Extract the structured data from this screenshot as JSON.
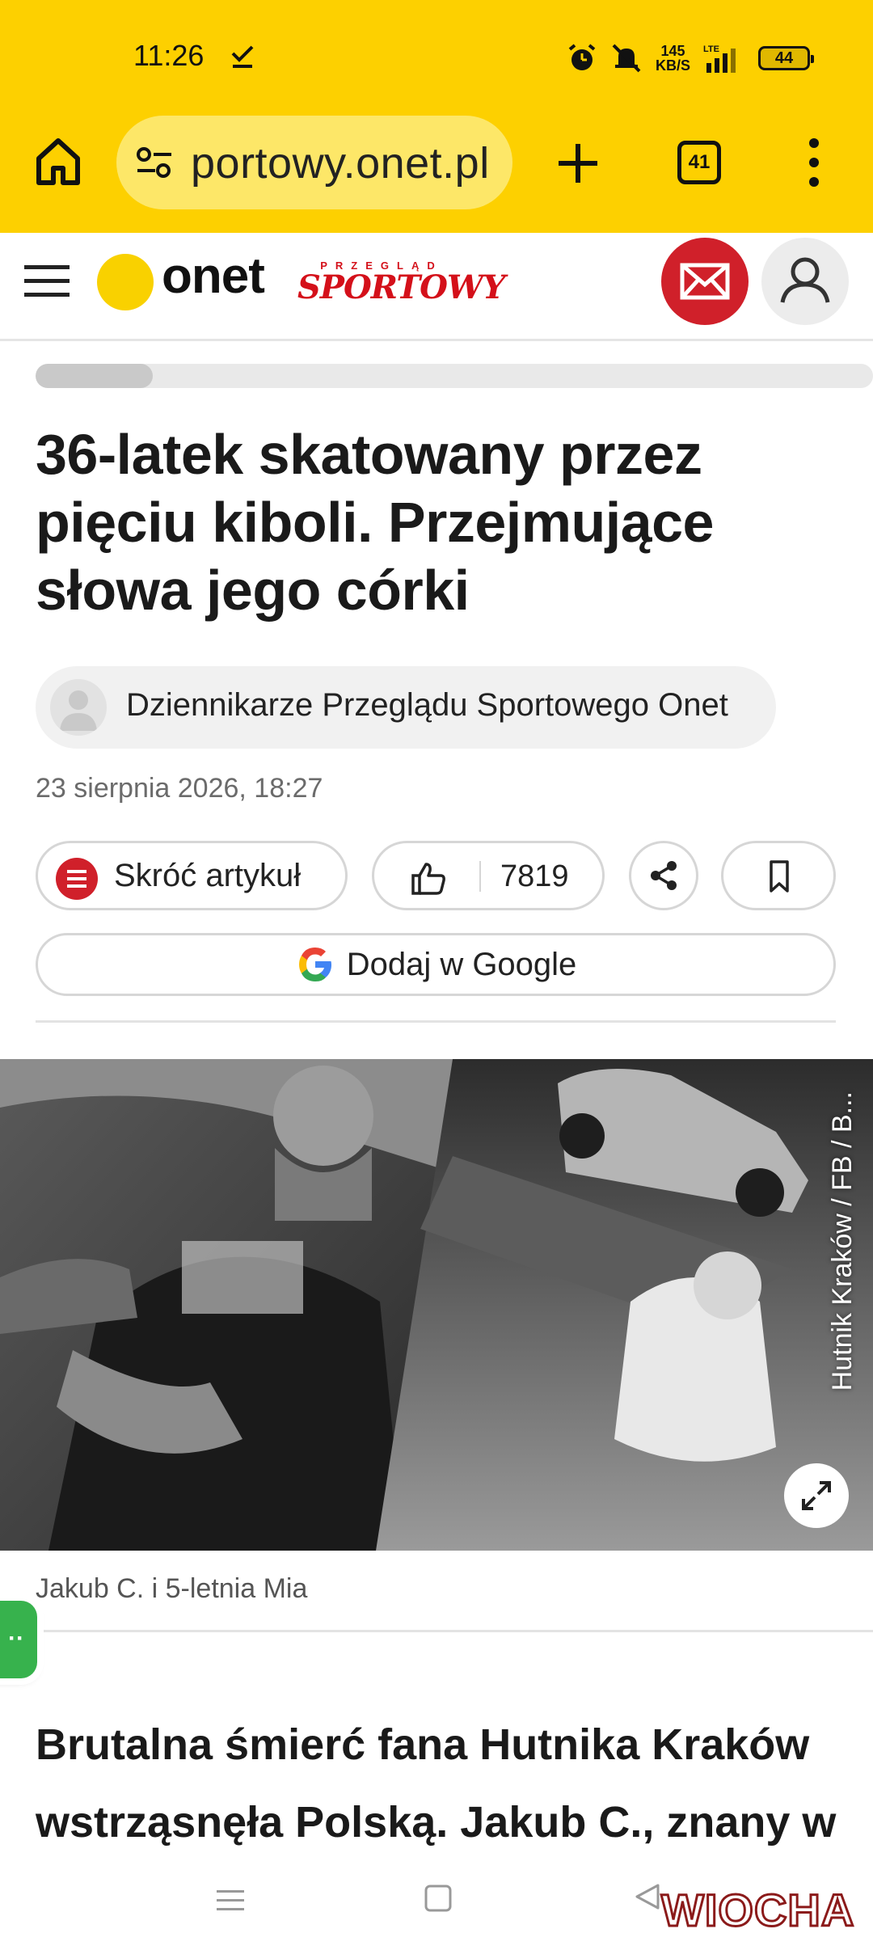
{
  "status_bar": {
    "time": "11:26",
    "net_speed_value": "145",
    "net_speed_unit": "KB/S",
    "lte": "LTE",
    "battery": "44"
  },
  "browser": {
    "url": "portowy.onet.pl",
    "tab_count": "41",
    "icons": [
      "home-icon",
      "tune-icon",
      "plus-icon",
      "tabs-icon",
      "more-vert-icon"
    ]
  },
  "site_header": {
    "logo": "onet",
    "sublogo_small": "PRZEGLĄD",
    "sublogo_big": "SPORTOWY",
    "colors": {
      "chrome_yellow": "#fdd000",
      "brand_red": "#d0202a",
      "logo_dot": "#f9d100"
    }
  },
  "article": {
    "reading_progress": 0.14,
    "title": "36-latek skatowany przez pięciu kiboli. Przejmujące słowa jego córki",
    "author": "Dziennikarze Przeglądu Sportowego Onet",
    "date": "23 sierpnia 2026, 18:27",
    "shorten_label": "Skróć artykuł",
    "like_count": "7819",
    "google_label": "Dodaj w Google",
    "photo_credit": "Hutnik Kraków / FB / B...",
    "photo_caption": "Jakub C. i 5-letnia Mia",
    "lead": "Brutalna śmierć fana Hutnika Kraków wstrząsnęła Polską. Jakub C., znany w"
  },
  "watermark": "WIOCHA"
}
